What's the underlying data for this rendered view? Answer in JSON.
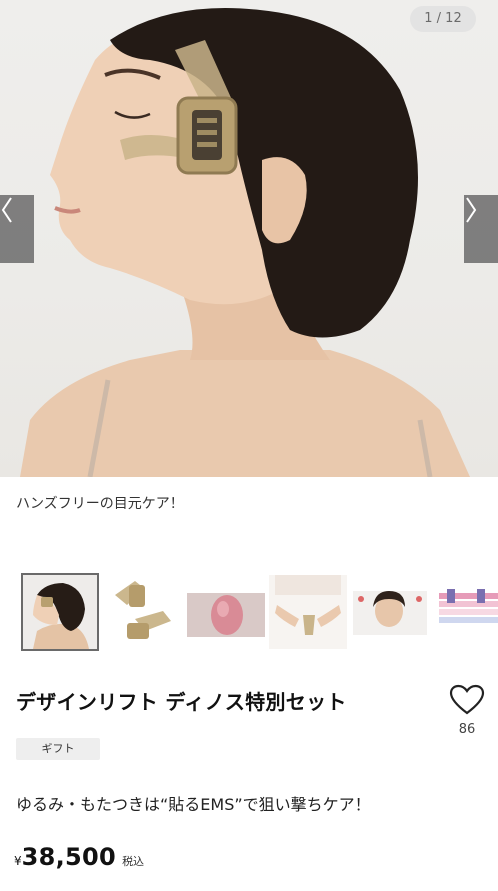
{
  "gallery": {
    "counter": "1 / 12",
    "prev_icon": "chevron-left-icon",
    "next_icon": "chevron-right-icon",
    "caption": "ハンズフリーの目元ケア！"
  },
  "thumbnails": [
    {
      "label": "face-with-device",
      "active": true
    },
    {
      "label": "device-parts",
      "active": false
    },
    {
      "label": "head-diagram",
      "active": false
    },
    {
      "label": "hands-holding-device",
      "active": false
    },
    {
      "label": "before-after-face",
      "active": false
    },
    {
      "label": "skin-layer-diagram",
      "active": false
    }
  ],
  "product": {
    "title": "デザインリフト ディノス特別セット",
    "tag": "ギフト",
    "catchcopy": "ゆるみ・もたつきは“貼るEMS”で狙い撃ちケア！",
    "price_yen": "¥",
    "price_amount": "38,500",
    "price_tax": "税込"
  },
  "favorite": {
    "icon": "heart-icon",
    "count": "86"
  }
}
